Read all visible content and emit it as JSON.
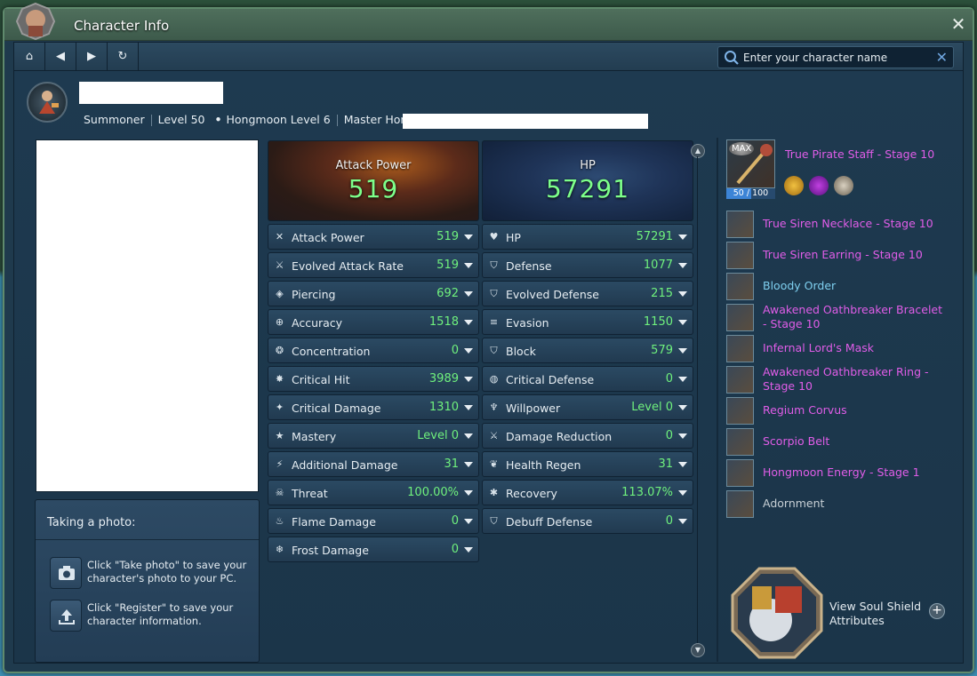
{
  "window": {
    "title": "Character Info",
    "close": "✕"
  },
  "search": {
    "placeholder": "Enter your character name",
    "clear": "✕"
  },
  "nav": {
    "home": "⌂",
    "back": "◀",
    "forward": "▶",
    "refresh": "↻"
  },
  "character": {
    "class": "Summoner",
    "level": "Level 50",
    "hongmoon": "Hongmoon Level 6",
    "school": "Master Hong"
  },
  "photo_help": {
    "title": "Taking a photo:",
    "take_photo_text": "Click \"Take photo\" to save your character's photo to your PC.",
    "register_text": "Click \"Register\" to save your character information."
  },
  "attack": {
    "banner_label": "Attack Power",
    "banner_value": "519",
    "stats": [
      {
        "label": "Attack Power",
        "value": "519",
        "icon": "crossed-swords-icon",
        "glyph": "✕"
      },
      {
        "label": "Evolved Attack Rate",
        "value": "519",
        "icon": "sword-icon",
        "glyph": "⚔"
      },
      {
        "label": "Piercing",
        "value": "692",
        "icon": "piercing-icon",
        "glyph": "◈"
      },
      {
        "label": "Accuracy",
        "value": "1518",
        "icon": "target-icon",
        "glyph": "⊕"
      },
      {
        "label": "Concentration",
        "value": "0",
        "icon": "concentration-icon",
        "glyph": "❂"
      },
      {
        "label": "Critical Hit",
        "value": "3989",
        "icon": "critical-hit-icon",
        "glyph": "✸"
      },
      {
        "label": "Critical Damage",
        "value": "1310",
        "icon": "critical-damage-icon",
        "glyph": "✦"
      },
      {
        "label": "Mastery",
        "value": "Level 0",
        "icon": "mastery-icon",
        "glyph": "★"
      },
      {
        "label": "Additional Damage",
        "value": "31",
        "icon": "additional-damage-icon",
        "glyph": "⚡"
      },
      {
        "label": "Threat",
        "value": "100.00%",
        "icon": "skull-icon",
        "glyph": "☠"
      },
      {
        "label": "Flame Damage",
        "value": "0",
        "icon": "flame-icon",
        "glyph": "♨"
      },
      {
        "label": "Frost Damage",
        "value": "0",
        "icon": "frost-icon",
        "glyph": "❄"
      }
    ]
  },
  "defense": {
    "banner_label": "HP",
    "banner_value": "57291",
    "stats": [
      {
        "label": "HP",
        "value": "57291",
        "icon": "heart-icon",
        "glyph": "♥"
      },
      {
        "label": "Defense",
        "value": "1077",
        "icon": "shield-icon",
        "glyph": "⛉"
      },
      {
        "label": "Evolved Defense",
        "value": "215",
        "icon": "evolved-shield-icon",
        "glyph": "⛉"
      },
      {
        "label": "Evasion",
        "value": "1150",
        "icon": "evasion-icon",
        "glyph": "≡"
      },
      {
        "label": "Block",
        "value": "579",
        "icon": "block-icon",
        "glyph": "⛉"
      },
      {
        "label": "Critical Defense",
        "value": "0",
        "icon": "critical-defense-icon",
        "glyph": "◍"
      },
      {
        "label": "Willpower",
        "value": "Level 0",
        "icon": "willpower-icon",
        "glyph": "♆"
      },
      {
        "label": "Damage Reduction",
        "value": "0",
        "icon": "damage-reduction-icon",
        "glyph": "⚔"
      },
      {
        "label": "Health Regen",
        "value": "31",
        "icon": "leaf-icon",
        "glyph": "❦"
      },
      {
        "label": "Recovery",
        "value": "113.07%",
        "icon": "recovery-icon",
        "glyph": "✱"
      },
      {
        "label": "Debuff Defense",
        "value": "0",
        "icon": "debuff-defense-icon",
        "glyph": "⛉"
      }
    ]
  },
  "equipment": {
    "weapon": {
      "name": "True Pirate Staff - Stage 10",
      "max": "MAX",
      "durability": "50 / 100",
      "durability_fraction": 0.5
    },
    "items": [
      {
        "name": "True Siren Necklace - Stage 10",
        "color": "purple",
        "two_line": false
      },
      {
        "name": "True Siren Earring - Stage 10",
        "color": "purple",
        "two_line": false
      },
      {
        "name": "Bloody Order",
        "color": "blue",
        "two_line": false
      },
      {
        "name": "Awakened Oathbreaker Bracelet - Stage 10",
        "color": "purple",
        "two_line": true
      },
      {
        "name": "Infernal Lord's Mask",
        "color": "purple",
        "two_line": false
      },
      {
        "name": "Awakened Oathbreaker Ring - Stage 10",
        "color": "purple",
        "two_line": true
      },
      {
        "name": "Regium Corvus",
        "color": "purple",
        "two_line": false
      },
      {
        "name": "Scorpio Belt",
        "color": "purple",
        "two_line": false
      },
      {
        "name": "Hongmoon Energy - Stage 1",
        "color": "purple",
        "two_line": false
      },
      {
        "name": "Adornment",
        "color": "gray",
        "two_line": false
      }
    ]
  },
  "soul_shield": {
    "label": "View Soul Shield Attributes",
    "plus": "+"
  },
  "colors": {
    "stat_value": "#6ff07d",
    "legendary": "#e05de8",
    "heroic": "#7fd0f0"
  }
}
